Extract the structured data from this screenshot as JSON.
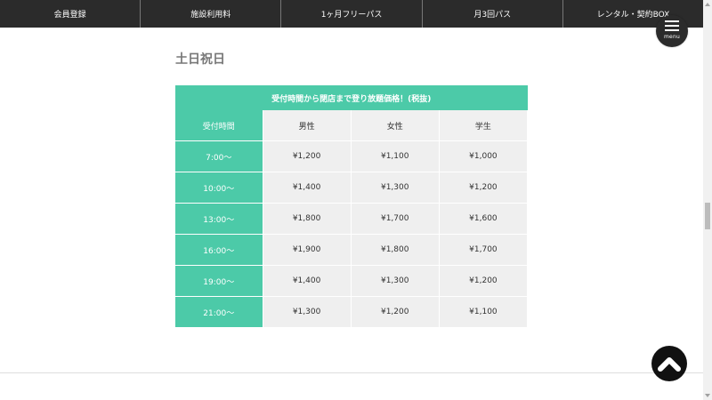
{
  "nav": {
    "items": [
      {
        "label": "会員登録"
      },
      {
        "label": "施設利用料"
      },
      {
        "label": "1ヶ月フリーパス"
      },
      {
        "label": "月3回パス"
      },
      {
        "label": "レンタル・契約BOX"
      }
    ]
  },
  "menu": {
    "label": "menu",
    "icon": "hamburger-icon"
  },
  "section": {
    "title": "土日祝日"
  },
  "table": {
    "caption": "受付時間から閉店まで登り放題価格！(税抜)",
    "headers": [
      "受付時間",
      "男性",
      "女性",
      "学生"
    ],
    "rows": [
      [
        "7:00～",
        "¥1,200",
        "¥1,100",
        "¥1,000"
      ],
      [
        "10:00～",
        "¥1,400",
        "¥1,300",
        "¥1,200"
      ],
      [
        "13:00～",
        "¥1,800",
        "¥1,700",
        "¥1,600"
      ],
      [
        "16:00～",
        "¥1,900",
        "¥1,800",
        "¥1,700"
      ],
      [
        "19:00～",
        "¥1,400",
        "¥1,300",
        "¥1,200"
      ],
      [
        "21:00～",
        "¥1,300",
        "¥1,200",
        "¥1,100"
      ]
    ]
  },
  "back_to_top": {
    "icon": "chevron-up-icon"
  },
  "colors": {
    "accent": "#4ccaa8",
    "nav_bg": "#2b2b2b",
    "cell_bg": "#efefef",
    "title": "#777777"
  }
}
